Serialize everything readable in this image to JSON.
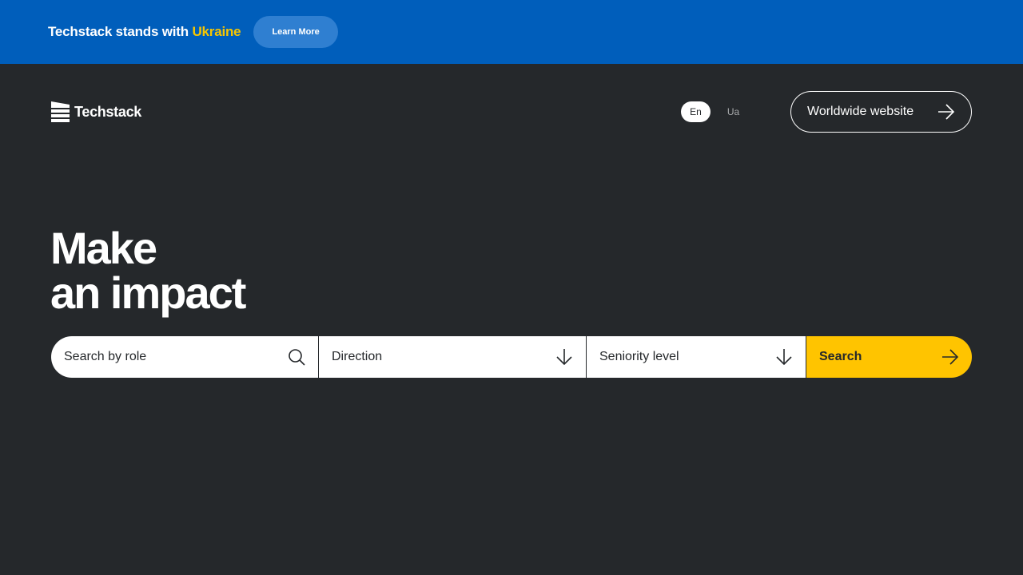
{
  "banner": {
    "text": "Techstack stands with",
    "highlight": "Ukraine",
    "button_label": "Learn More"
  },
  "header": {
    "logo_text": "Techstack",
    "languages": [
      {
        "label": "En",
        "active": true
      },
      {
        "label": "Ua",
        "active": false
      }
    ],
    "worldwide_label": "Worldwide website"
  },
  "hero": {
    "title_line1": "Make",
    "title_line2": "an impact"
  },
  "search": {
    "role_placeholder": "Search by role",
    "direction_label": "Direction",
    "seniority_label": "Seniority level",
    "button_label": "Search"
  },
  "colors": {
    "banner_bg": "#005ebb",
    "page_bg": "#25282b",
    "accent_yellow": "#ffc400",
    "highlight_yellow": "#f7c600"
  },
  "icons": [
    "logo-mark-icon",
    "arrow-right-icon",
    "search-icon",
    "arrow-down-icon"
  ]
}
